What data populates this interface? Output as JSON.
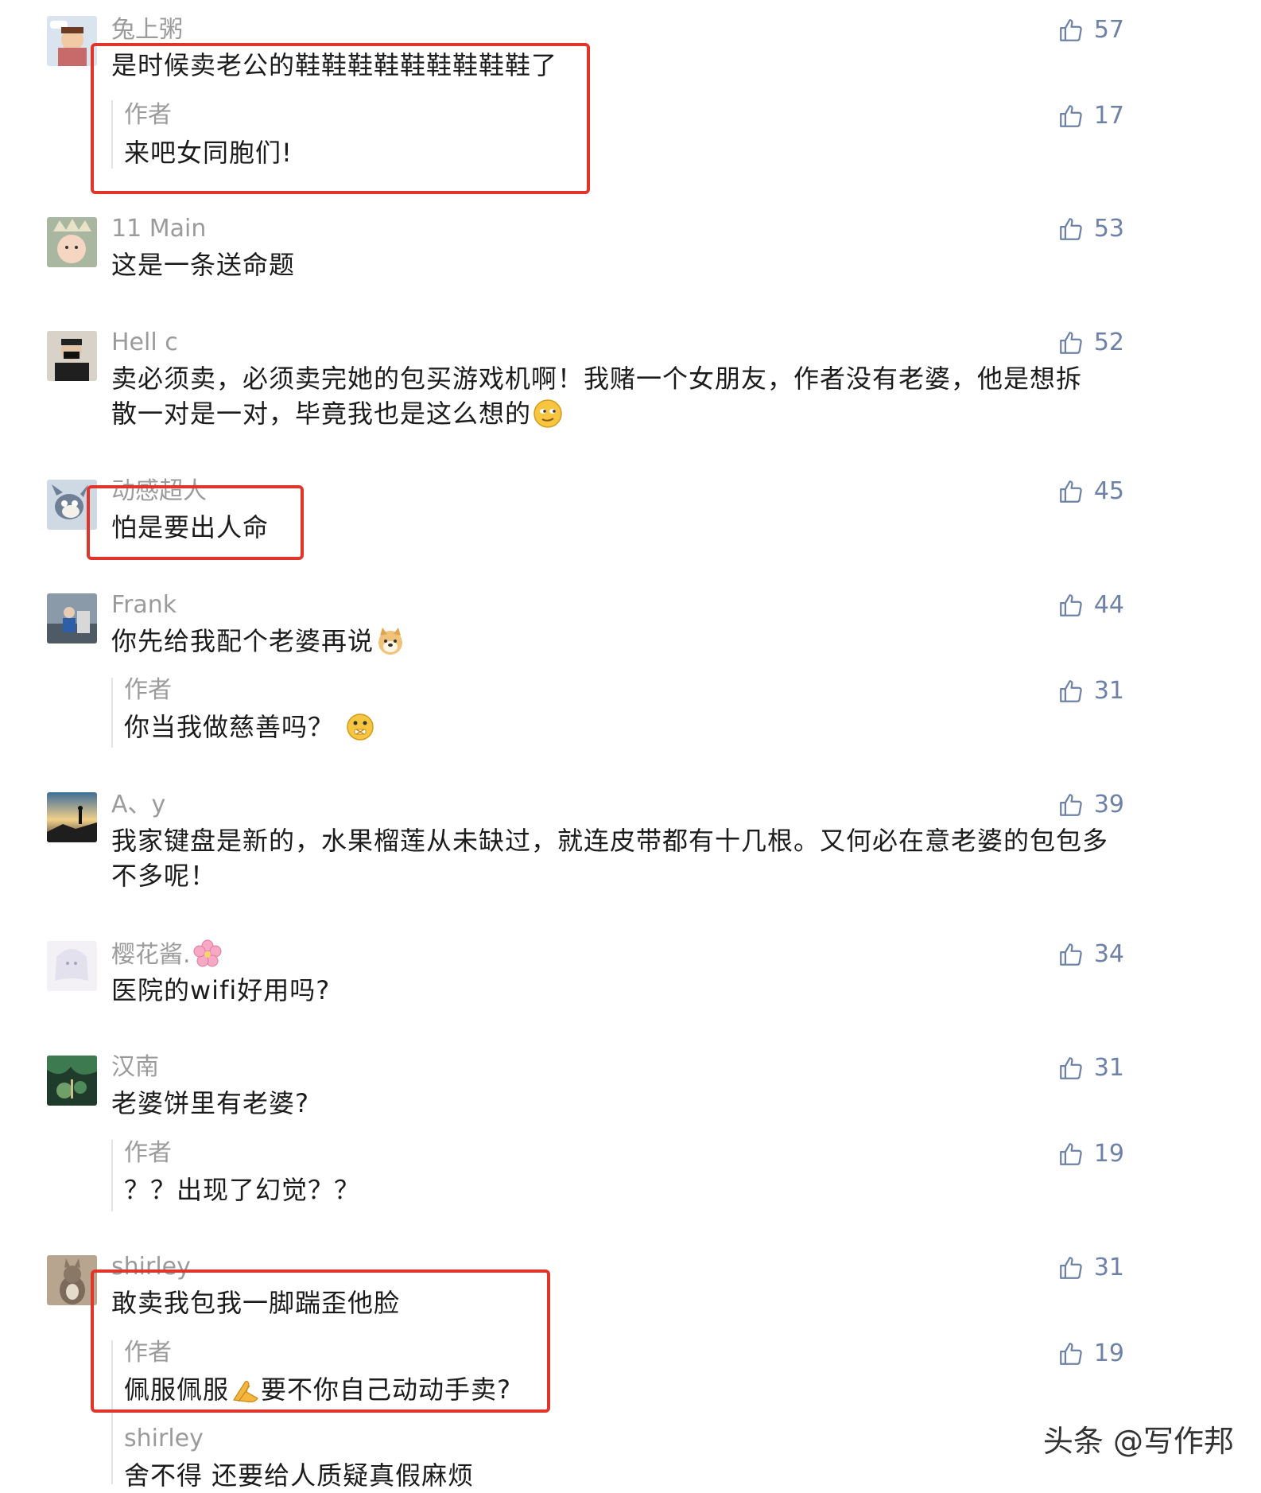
{
  "comments": [
    {
      "name": "兔上粥",
      "text": "是时候卖老公的鞋鞋鞋鞋鞋鞋鞋鞋鞋了",
      "likes": "57",
      "reply": {
        "name": "作者",
        "text": "来吧女同胞们!",
        "likes": "17"
      }
    },
    {
      "name": "11 Main",
      "text": "这是一条送命题",
      "likes": "53"
    },
    {
      "name": "Hell c",
      "text": "卖必须卖，必须卖完她的包买游戏机啊！我赌一个女朋友，作者没有老婆，他是想拆散一对是一对，毕竟我也是这么想的",
      "likes": "52"
    },
    {
      "name": "动感超人",
      "text": "怕是要出人命",
      "likes": "45"
    },
    {
      "name": "Frank",
      "text": "你先给我配个老婆再说",
      "likes": "44",
      "reply": {
        "name": "作者",
        "text": "你当我做慈善吗？",
        "likes": "31"
      }
    },
    {
      "name": "A、y",
      "text": "我家键盘是新的，水果榴莲从未缺过，就连皮带都有十几根。又何必在意老婆的包包多不多呢！",
      "likes": "39"
    },
    {
      "name": "樱花酱.",
      "text": "医院的wifi好用吗?",
      "likes": "34"
    },
    {
      "name": "汉南",
      "text": "老婆饼里有老婆?",
      "likes": "31",
      "reply": {
        "name": "作者",
        "text": "？？出现了幻觉？？",
        "likes": "19"
      }
    },
    {
      "name": "shirley",
      "text": "敢卖我包我一脚踹歪他脸",
      "likes": "31",
      "reply": {
        "name": "作者",
        "text_a": "佩服佩服",
        "text_b": "要不你自己动动手卖?",
        "likes": "19"
      },
      "reply2": {
        "name": "shirley",
        "text": "舍不得 还要给人质疑真假麻烦"
      }
    }
  ],
  "watermark": "头条 @写作邦",
  "colors": {
    "highlight": "#e0352b",
    "like": "#6d82a6",
    "name": "#9b9b9b"
  }
}
